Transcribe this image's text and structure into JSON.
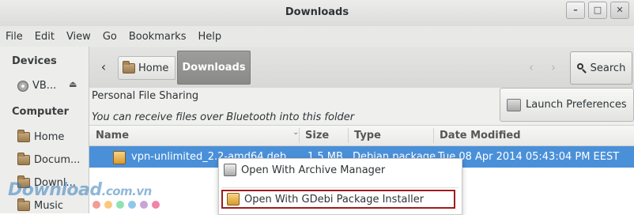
{
  "window": {
    "title": "Downloads",
    "controls": {
      "minimize": "–",
      "maximize": "□",
      "close": "✕"
    }
  },
  "menubar": [
    "File",
    "Edit",
    "View",
    "Go",
    "Bookmarks",
    "Help"
  ],
  "sidebar": {
    "devices_heading": "Devices",
    "device_name": "VB...",
    "computer_heading": "Computer",
    "items": [
      "Home",
      "Docum...",
      "Downl...",
      "Music"
    ]
  },
  "toolbar": {
    "back": "‹",
    "path_home": "Home",
    "path_current": "Downloads",
    "prev_arrow": "‹",
    "next_arrow": "›",
    "search_label": "Search"
  },
  "infobar": {
    "title": "Personal File Sharing",
    "description": "You can receive files over Bluetooth into this folder",
    "launch_button": "Launch Preferences"
  },
  "columns": {
    "name": "Name",
    "size": "Size",
    "type": "Type",
    "date_modified": "Date Modified"
  },
  "file": {
    "name": "vpn-unlimited_2.2-amd64.deb",
    "size": "1.5 MB",
    "type": "Debian package",
    "date": "Tue 08 Apr 2014 05:43:04 PM EEST"
  },
  "context_menu": {
    "item1": "Open With Archive Manager",
    "item2": "Open With GDebi Package Installer"
  },
  "watermark": {
    "text": "Download",
    "domain": ".com.vn"
  },
  "colors": {
    "selection": "#4a90d9",
    "highlight_border": "#9e1c1f",
    "path_active": "#8f8f8d",
    "watermark_dots": [
      "#e74c3c",
      "#f39c12",
      "#2ecc71",
      "#3498db",
      "#9b59b6",
      "#e91e63"
    ]
  }
}
